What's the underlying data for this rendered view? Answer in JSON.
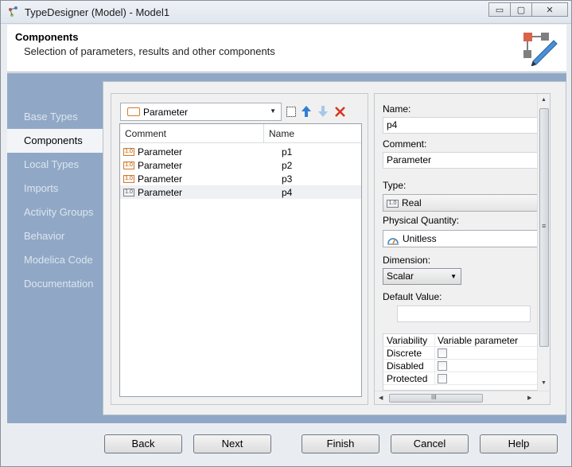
{
  "window": {
    "title": "TypeDesigner (Model) - Model1",
    "controls": {
      "minimize": "▭",
      "maximize": "▢",
      "close": "✕"
    }
  },
  "header": {
    "title": "Components",
    "subtitle": "Selection of parameters, results and other components",
    "icon": "edit-diagram-icon"
  },
  "sidebar": {
    "items": [
      {
        "label": "Base Types",
        "active": false
      },
      {
        "label": "Components",
        "active": true
      },
      {
        "label": "Local Types",
        "active": false
      },
      {
        "label": "Imports",
        "active": false
      },
      {
        "label": "Activity Groups",
        "active": false
      },
      {
        "label": "Behavior",
        "active": false
      },
      {
        "label": "Modelica Code",
        "active": false
      },
      {
        "label": "Documentation",
        "active": false
      }
    ]
  },
  "components": {
    "filter": {
      "value": "Parameter"
    },
    "toolbar": {
      "new_icon": "new-document-icon",
      "up_icon": "arrow-up-icon",
      "down_icon": "arrow-down-icon",
      "delete_icon": "delete-icon"
    },
    "columns": {
      "comment": "Comment",
      "name": "Name"
    },
    "row_badge": "1.0",
    "rows": [
      {
        "comment": "Parameter",
        "name": "p1",
        "selected": false
      },
      {
        "comment": "Parameter",
        "name": "p2",
        "selected": false
      },
      {
        "comment": "Parameter",
        "name": "p3",
        "selected": false
      },
      {
        "comment": "Parameter",
        "name": "p4",
        "selected": true
      }
    ]
  },
  "properties": {
    "name_label": "Name:",
    "name_value": "p4",
    "comment_label": "Comment:",
    "comment_value": "Parameter",
    "type_label": "Type:",
    "type_value": "Real",
    "type_badge": "1.0",
    "quantity_label": "Physical Quantity:",
    "quantity_value": "Unitless",
    "dimension_label": "Dimension:",
    "dimension_value": "Scalar",
    "default_label": "Default Value:",
    "default_value": "",
    "variability": {
      "header": [
        "Variability",
        "Variable parameter"
      ],
      "rows": [
        {
          "label": "Discrete",
          "checked": false
        },
        {
          "label": "Disabled",
          "checked": false
        },
        {
          "label": "Protected",
          "checked": false
        }
      ]
    },
    "scroll": {
      "up": "▲",
      "down": "▼",
      "left": "◀",
      "right": "▶",
      "vgrip": "≡",
      "hgrip": "III"
    }
  },
  "buttons": {
    "back": "Back",
    "next": "Next",
    "finish": "Finish",
    "cancel": "Cancel",
    "help": "Help"
  },
  "colors": {
    "accent_orange": "#d37a2a",
    "nav_bg": "#90a8c6",
    "delete_red": "#d2381e",
    "arrow_blue": "#2f7fd1"
  }
}
